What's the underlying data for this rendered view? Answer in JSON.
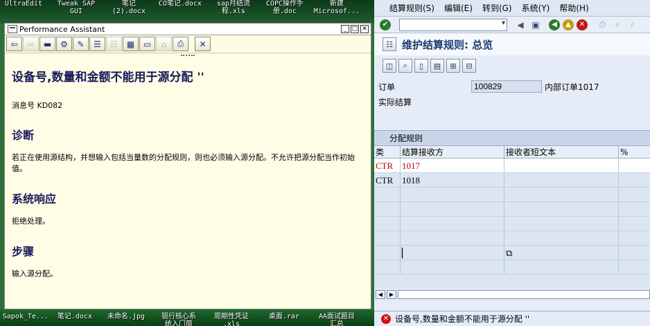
{
  "desktop": {
    "top_icons": [
      "UltraEdit",
      "Tweak SAP\nGUI",
      "笔记\n(2).docx",
      "CO笔记.docx",
      "sap月结流\n程.xls",
      "COPC操作手\n册.doc",
      "新建\nMicrosof..."
    ],
    "bottom_icons": [
      "Sapok_Te...",
      "笔记.docx",
      "未命名.jpg",
      "银行核心系\n统入门简",
      "周期性凭证\n.xls",
      "桌面.rar",
      "AA面试题目\n汇总"
    ]
  },
  "pa": {
    "window_title": "Performance Assistant",
    "heading": "设备号,数量和金额不能用于源分配 ''",
    "msg_no": "消息号 KD082",
    "diag_title": "诊断",
    "diag_text": "若正在使用源结构，并想输入包括当量数的分配规则，则也必须输入源分配。不允许把源分配当作初始值。",
    "resp_title": "系统响应",
    "resp_text": "拒绝处理。",
    "steps_title": "步骤",
    "steps_text": "输入源分配。"
  },
  "sap": {
    "menu": [
      "结算规则(S)",
      "编辑(E)",
      "转到(G)",
      "系统(Y)",
      "帮助(H)"
    ],
    "title": "维护结算规则: 总览",
    "order_label": "订单",
    "order_value": "100829",
    "order_desc": "内部订单1017",
    "actual_label": "实际结算",
    "table": {
      "caption": "分配规则",
      "headers": [
        "类",
        "结算接收方",
        "接收者短文本",
        "%"
      ],
      "rows": [
        {
          "type": "CTR",
          "receiver": "1017"
        },
        {
          "type": "CTR",
          "receiver": "1018"
        }
      ]
    },
    "status_message": "设备号,数量和金额不能用于源分配 ''",
    "colors": {
      "error": "#d41010",
      "title": "#1d3b74"
    }
  }
}
